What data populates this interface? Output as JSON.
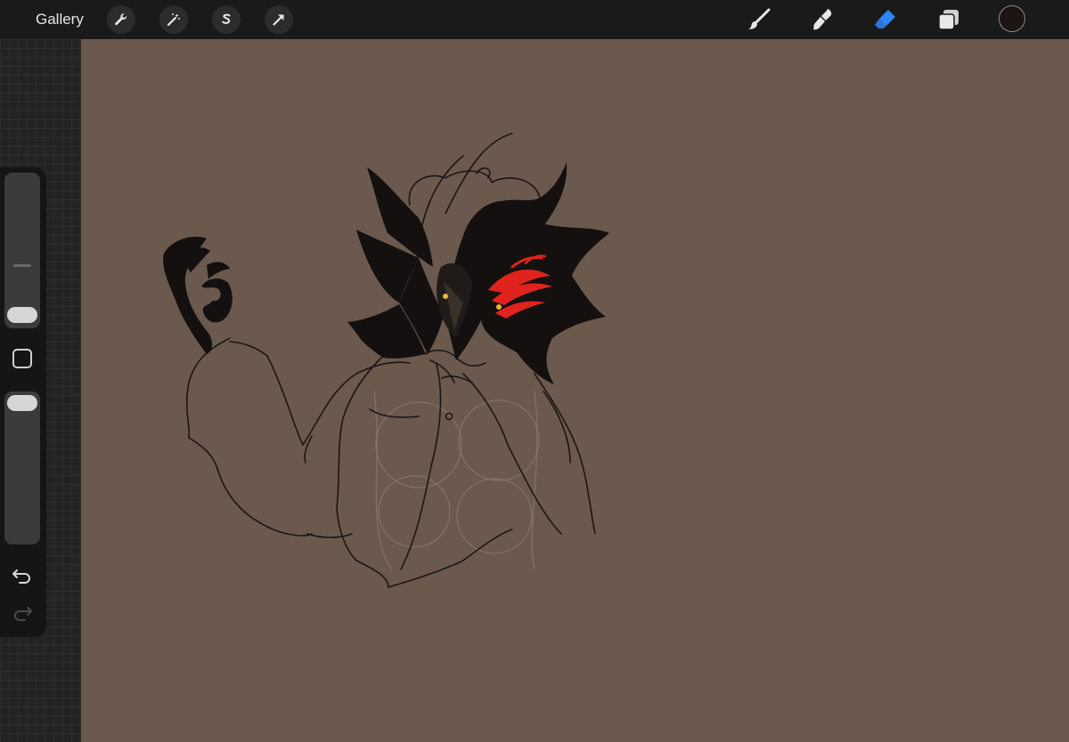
{
  "toolbar": {
    "gallery_label": "Gallery",
    "left_tools": [
      {
        "name": "actions-wrench-icon"
      },
      {
        "name": "adjustments-magic-wand-icon"
      },
      {
        "name": "selection-s-icon"
      },
      {
        "name": "transform-arrow-icon"
      }
    ],
    "right_tools": [
      {
        "name": "brush-icon",
        "active": false
      },
      {
        "name": "smudge-icon",
        "active": false
      },
      {
        "name": "eraser-icon",
        "active": true
      },
      {
        "name": "layers-icon",
        "active": false
      }
    ],
    "current_color": "#1c1412",
    "active_tool_color": "#2f86f6"
  },
  "sidebar": {
    "brush_size_level": 0.0,
    "opacity_level": 1.0,
    "undo_icon": "undo-arrow-icon",
    "redo_icon": "redo-arrow-icon"
  },
  "canvas": {
    "background_color": "#6b594d",
    "ink_color": "#141010",
    "eye_accent_color": "#e0231c",
    "eye_glint_color": "#e9b73a"
  }
}
